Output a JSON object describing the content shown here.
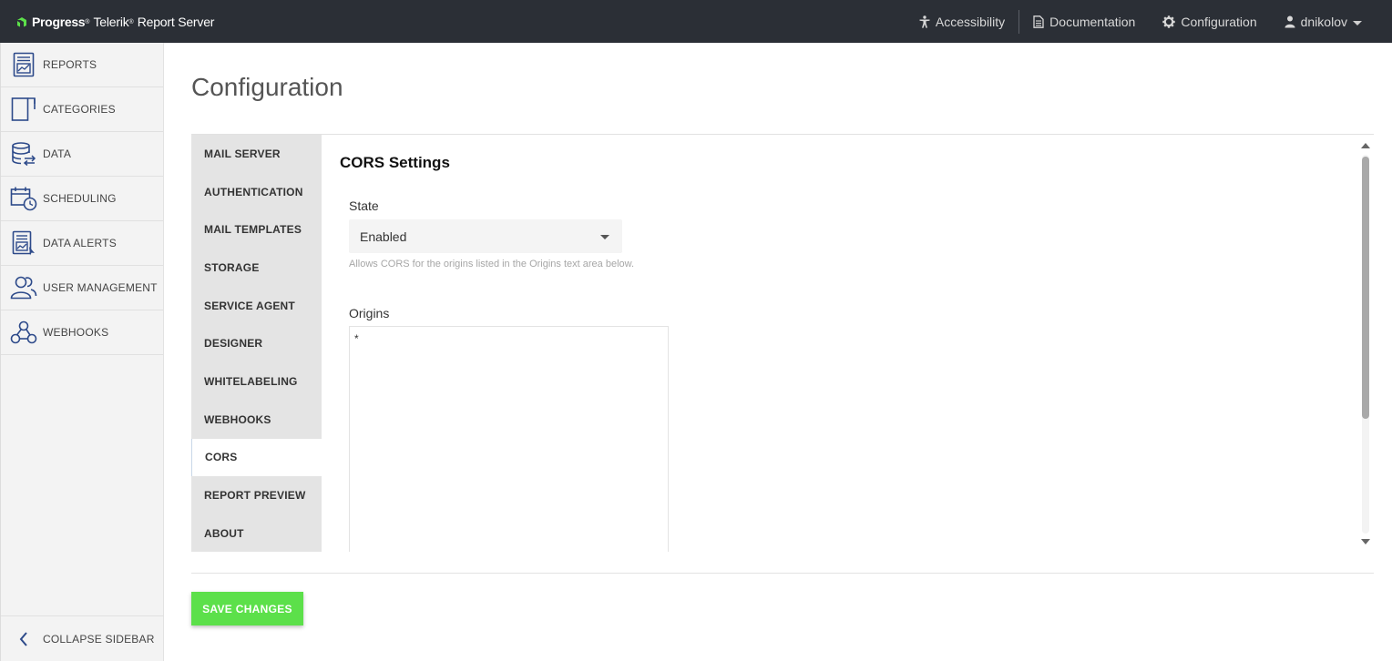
{
  "topbar": {
    "brand_primary": "Progress",
    "brand_secondary": "Telerik",
    "brand_product": "Report Server",
    "nav": {
      "accessibility": "Accessibility",
      "documentation": "Documentation",
      "configuration": "Configuration",
      "user": "dnikolov"
    }
  },
  "sidebar": {
    "items": [
      {
        "label": "REPORTS",
        "icon": "report-icon"
      },
      {
        "label": "CATEGORIES",
        "icon": "categories-icon"
      },
      {
        "label": "DATA",
        "icon": "database-icon"
      },
      {
        "label": "SCHEDULING",
        "icon": "calendar-clock-icon"
      },
      {
        "label": "DATA ALERTS",
        "icon": "alert-report-icon"
      },
      {
        "label": "USER MANAGEMENT",
        "icon": "users-icon"
      },
      {
        "label": "WEBHOOKS",
        "icon": "webhook-icon"
      }
    ],
    "collapse_label": "COLLAPSE SIDEBAR"
  },
  "page": {
    "title": "Configuration"
  },
  "config_nav": {
    "items": [
      "MAIL SERVER",
      "AUTHENTICATION",
      "MAIL TEMPLATES",
      "STORAGE",
      "SERVICE AGENT",
      "DESIGNER",
      "WHITELABELING",
      "WEBHOOKS",
      "CORS",
      "REPORT PREVIEW",
      "ABOUT"
    ],
    "active": "CORS"
  },
  "cors": {
    "heading": "CORS Settings",
    "state_label": "State",
    "state_value": "Enabled",
    "state_hint": "Allows CORS for the origins listed in the Origins text area below.",
    "origins_label": "Origins",
    "origins_value": "*"
  },
  "actions": {
    "save_label": "SAVE CHANGES"
  },
  "colors": {
    "topbar_bg": "#2b2f36",
    "save_button": "#5ce04a",
    "icon_blue": "#2d4a8a"
  }
}
